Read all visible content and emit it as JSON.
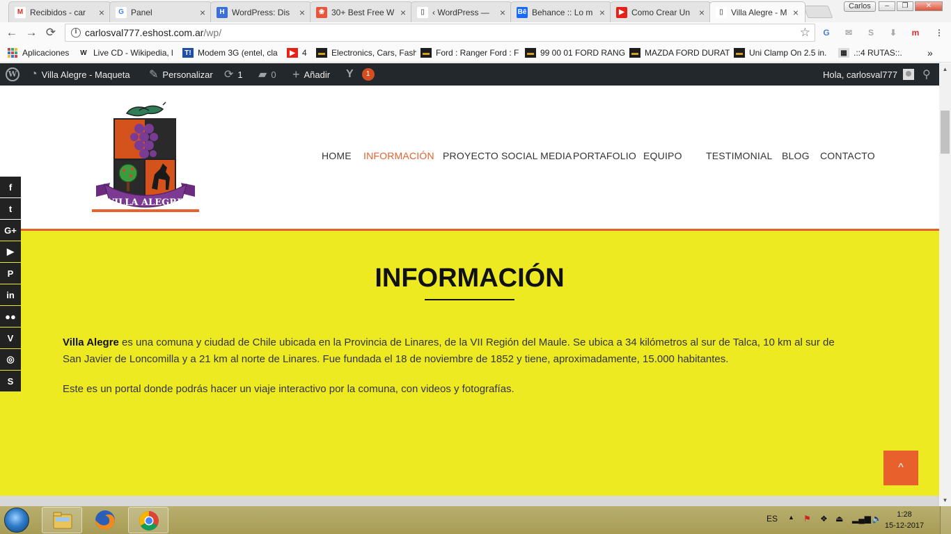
{
  "browser": {
    "tabs": [
      {
        "title": "Recibidos - car",
        "favicon": "gmail-icon",
        "active": false
      },
      {
        "title": "Panel",
        "favicon": "google-icon",
        "active": false
      },
      {
        "title": "WordPress: Dis",
        "favicon": "hootsuite-icon",
        "active": false
      },
      {
        "title": "30+ Best Free W",
        "favicon": "colorful-icon",
        "active": false
      },
      {
        "title": "‹ WordPress —",
        "favicon": "page-icon",
        "active": false
      },
      {
        "title": "Behance :: Lo m",
        "favicon": "behance-icon",
        "active": false
      },
      {
        "title": "Como Crear Un",
        "favicon": "youtube-icon",
        "active": false
      },
      {
        "title": "Villa Alegre - M",
        "favicon": "page-icon",
        "active": true
      }
    ],
    "close_glyph": "×",
    "profile_name": "Carlos",
    "window_controls": {
      "minimize": "–",
      "restore": "❐",
      "close": "✕"
    },
    "url_host": "carlosval777.eshost.com.ar",
    "url_path": "/wp/",
    "nav": {
      "back": "←",
      "forward": "→",
      "reload": "⟳",
      "info": "i",
      "star": "☆"
    },
    "extensions": [
      {
        "name": "translate-extension-icon",
        "glyph": "G",
        "color": "#4a7fd6"
      },
      {
        "name": "mail-extension-icon",
        "glyph": "✉",
        "color": "#aaaaaa"
      },
      {
        "name": "skype-extension-icon",
        "glyph": "S",
        "color": "#aaaaaa"
      },
      {
        "name": "download-extension-icon",
        "glyph": "⬇",
        "color": "#aaaaaa"
      },
      {
        "name": "m-extension-icon",
        "glyph": "m",
        "color": "#d62a2a"
      },
      {
        "name": "menu-icon",
        "glyph": "⋮",
        "color": "#555555"
      }
    ],
    "bookmarks": [
      {
        "label": "Aplicaciones",
        "icon": "apps-icon"
      },
      {
        "label": "Live CD - Wikipedia, l",
        "icon": "wikipedia-icon"
      },
      {
        "label": "Modem 3G (entel, cla",
        "icon": "t-icon"
      },
      {
        "label": "4",
        "icon": "youtube-icon"
      },
      {
        "label": "Electronics, Cars, Fash",
        "icon": "ebay-icon"
      },
      {
        "label": "Ford : Ranger Ford : F",
        "icon": "ebay-icon"
      },
      {
        "label": "99 00 01 FORD RANG",
        "icon": "ebay-icon"
      },
      {
        "label": "MAZDA FORD DURAT",
        "icon": "ebay-icon"
      },
      {
        "label": "Uni Clamp On 2.5 in.",
        "icon": "ebay-icon"
      },
      {
        "label": ".::4 RUTAS::.",
        "icon": "rutas-icon"
      }
    ],
    "bookmarks_overflow": "»"
  },
  "adminbar": {
    "site_name": "Villa Alegre - Maqueta",
    "customize": "Personalizar",
    "updates_count": "1",
    "comments_count": "0",
    "add_new": "Añadir",
    "yoast_badge": "1",
    "greeting": "Hola, carlosval777"
  },
  "site": {
    "logo_text": "VILLA ALEGRE",
    "menu": [
      {
        "label": "HOME",
        "current": false
      },
      {
        "label": "INFORMACIÓN",
        "current": true
      },
      {
        "label": "PROYECTO SOCIAL MEDIA",
        "current": false
      },
      {
        "label": "PORTAFOLIO",
        "current": false
      },
      {
        "label": "EQUIPO",
        "current": false
      },
      {
        "label": "TESTIMONIAL",
        "current": false
      },
      {
        "label": "BLOG",
        "current": false
      },
      {
        "label": "CONTACTO",
        "current": false
      }
    ],
    "accent_color": "#e8602c",
    "section_bg_color": "#eeea21"
  },
  "content": {
    "title": "INFORMACIÓN",
    "para1_bold": "Villa Alegre",
    "para1_line1": " es una comuna y ciudad de Chile ubicada en la Provincia de Linares, de la VII Región del Maule. Se ubica a 34 kilómetros al sur de Talca, 10 km al sur de",
    "para1_line2": "San Javier de Loncomilla y a 21 km al norte de Linares. Fue fundada el 18 de noviembre de 1852 y tiene, aproximadamente, 15.000 habitantes.",
    "para2": "Este es un portal donde podrás hacer un viaje interactivo por la comuna, con videos y fotografías.",
    "back_to_top": "^"
  },
  "social": [
    {
      "name": "facebook-icon",
      "glyph": "f"
    },
    {
      "name": "twitter-icon",
      "glyph": "t"
    },
    {
      "name": "google-plus-icon",
      "glyph": "G+"
    },
    {
      "name": "youtube-icon",
      "glyph": "▶"
    },
    {
      "name": "pinterest-icon",
      "glyph": "P"
    },
    {
      "name": "linkedin-icon",
      "glyph": "in"
    },
    {
      "name": "flickr-icon",
      "glyph": "●●"
    },
    {
      "name": "vimeo-icon",
      "glyph": "V"
    },
    {
      "name": "instagram-icon",
      "glyph": "◎"
    },
    {
      "name": "skype-icon",
      "glyph": "S"
    }
  ],
  "taskbar": {
    "language": "ES",
    "time": "1:28",
    "date": "15-12-2017"
  }
}
